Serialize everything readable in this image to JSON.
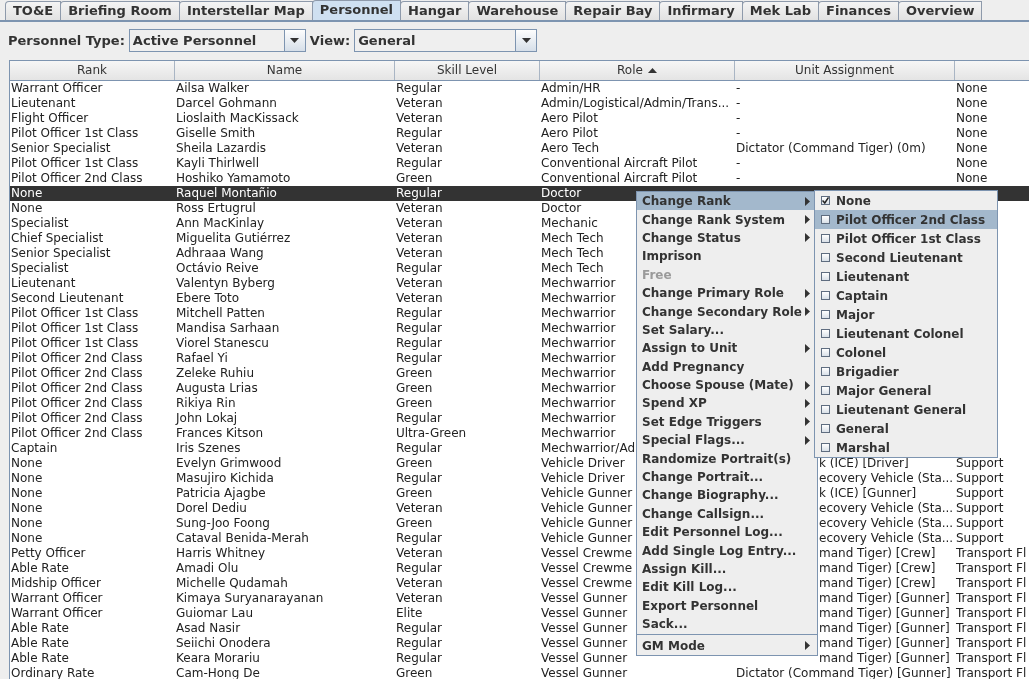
{
  "tabs": [
    {
      "label": "TO&E",
      "selected": false
    },
    {
      "label": "Briefing Room",
      "selected": false
    },
    {
      "label": "Interstellar Map",
      "selected": false
    },
    {
      "label": "Personnel",
      "selected": true
    },
    {
      "label": "Hangar",
      "selected": false
    },
    {
      "label": "Warehouse",
      "selected": false
    },
    {
      "label": "Repair Bay",
      "selected": false
    },
    {
      "label": "Infirmary",
      "selected": false
    },
    {
      "label": "Mek Lab",
      "selected": false
    },
    {
      "label": "Finances",
      "selected": false
    },
    {
      "label": "Overview",
      "selected": false
    }
  ],
  "filters": {
    "personnel_type_label": "Personnel Type:",
    "personnel_type": "Active Personnel",
    "view_label": "View:",
    "view": "General"
  },
  "table": {
    "columns": [
      {
        "label": "Rank",
        "sorted": false
      },
      {
        "label": "Name",
        "sorted": false
      },
      {
        "label": "Skill Level",
        "sorted": false
      },
      {
        "label": "Role",
        "sorted": true
      },
      {
        "label": "Unit Assignment",
        "sorted": false
      }
    ],
    "rows": [
      {
        "rank": "Warrant Officer",
        "name": "Ailsa Walker",
        "skill_level": "Regular",
        "role": "Admin/HR",
        "unit_assignment": "-",
        "column_6": "None",
        "selected": false
      },
      {
        "rank": "Lieutenant",
        "name": "Darcel Gohmann",
        "skill_level": "Veteran",
        "role": "Admin/Logistical/Admin/Trans...",
        "unit_assignment": "-",
        "column_6": "None",
        "selected": false
      },
      {
        "rank": "Flight Officer",
        "name": "Lioslaith MacKissack",
        "skill_level": "Veteran",
        "role": "Aero Pilot",
        "unit_assignment": "-",
        "column_6": "None",
        "selected": false
      },
      {
        "rank": "Pilot Officer 1st Class",
        "name": "Giselle Smith",
        "skill_level": "Regular",
        "role": "Aero Pilot",
        "unit_assignment": "-",
        "column_6": "None",
        "selected": false
      },
      {
        "rank": "Senior Specialist",
        "name": "Sheila Lazardis",
        "skill_level": "Veteran",
        "role": "Aero Tech",
        "unit_assignment": "Dictator (Command Tiger) (0m)",
        "column_6": "None",
        "selected": false
      },
      {
        "rank": "Pilot Officer 1st Class",
        "name": "Kayli Thirlwell",
        "skill_level": "Regular",
        "role": "Conventional Aircraft Pilot",
        "unit_assignment": "-",
        "column_6": "None",
        "selected": false
      },
      {
        "rank": "Pilot Officer 2nd Class",
        "name": "Hoshiko Yamamoto",
        "skill_level": "Green",
        "role": "Conventional Aircraft Pilot",
        "unit_assignment": "-",
        "column_6": "None",
        "selected": false
      },
      {
        "rank": "None",
        "name": "Raquel Montañio",
        "skill_level": "Regular",
        "role": "Doctor",
        "selected": true
      },
      {
        "rank": "None",
        "name": "Ross Ertugrul",
        "skill_level": "Veteran",
        "role": "Doctor",
        "selected": false
      },
      {
        "rank": "Specialist",
        "name": "Ann MacKinlay",
        "skill_level": "Veteran",
        "role": "Mechanic",
        "selected": false
      },
      {
        "rank": "Chief Specialist",
        "name": "Miguelita Gutiérrez",
        "skill_level": "Veteran",
        "role": "Mech Tech",
        "selected": false
      },
      {
        "rank": "Senior Specialist",
        "name": "Adhraaa Wang",
        "skill_level": "Veteran",
        "role": "Mech Tech",
        "selected": false
      },
      {
        "rank": "Specialist",
        "name": "Octávio Reive",
        "skill_level": "Regular",
        "role": "Mech Tech",
        "selected": false
      },
      {
        "rank": "Lieutenant",
        "name": "Valentyn Byberg",
        "skill_level": "Veteran",
        "role": "Mechwarrior",
        "selected": false
      },
      {
        "rank": "Second Lieutenant",
        "name": "Ebere Toto",
        "skill_level": "Veteran",
        "role": "Mechwarrior",
        "selected": false
      },
      {
        "rank": "Pilot Officer 1st Class",
        "name": "Mitchell Patten",
        "skill_level": "Regular",
        "role": "Mechwarrior",
        "selected": false
      },
      {
        "rank": "Pilot Officer 1st Class",
        "name": "Mandisa Sarhaan",
        "skill_level": "Regular",
        "role": "Mechwarrior",
        "selected": false
      },
      {
        "rank": "Pilot Officer 1st Class",
        "name": "Viorel Stanescu",
        "skill_level": "Regular",
        "role": "Mechwarrior",
        "selected": false
      },
      {
        "rank": "Pilot Officer 2nd Class",
        "name": "Rafael Yi",
        "skill_level": "Regular",
        "role": "Mechwarrior",
        "selected": false
      },
      {
        "rank": "Pilot Officer 2nd Class",
        "name": "Zeleke Ruhiu",
        "skill_level": "Green",
        "role": "Mechwarrior",
        "selected": false
      },
      {
        "rank": "Pilot Officer 2nd Class",
        "name": "Augusta Lrias",
        "skill_level": "Green",
        "role": "Mechwarrior",
        "selected": false
      },
      {
        "rank": "Pilot Officer 2nd Class",
        "name": "Rikiya Rin",
        "skill_level": "Green",
        "role": "Mechwarrior",
        "selected": false
      },
      {
        "rank": "Pilot Officer 2nd Class",
        "name": "John Lokaj",
        "skill_level": "Regular",
        "role": "Mechwarrior",
        "selected": false
      },
      {
        "rank": "Pilot Officer 2nd Class",
        "name": "Frances Kitson",
        "skill_level": "Ultra-Green",
        "role": "Mechwarrior",
        "selected": false
      },
      {
        "rank": "Captain",
        "name": "Iris Szenes",
        "skill_level": "Regular",
        "role": "Mechwarrior/Ad",
        "selected": false
      },
      {
        "rank": "None",
        "name": "Evelyn Grimwood",
        "skill_level": "Green",
        "role": "Vehicle Driver",
        "unit_assignment": "k (ICE) [Driver]",
        "column_6": "Support",
        "selected": false
      },
      {
        "rank": "None",
        "name": "Masujiro Kichida",
        "skill_level": "Regular",
        "role": "Vehicle Driver",
        "unit_assignment": "ecovery Vehicle (Sta...",
        "column_6": "Support",
        "selected": false
      },
      {
        "rank": "None",
        "name": "Patricia Ajagbe",
        "skill_level": "Green",
        "role": "Vehicle Gunner",
        "unit_assignment": "k (ICE) [Gunner]",
        "column_6": "Support",
        "selected": false
      },
      {
        "rank": "None",
        "name": "Dorel Dediu",
        "skill_level": "Veteran",
        "role": "Vehicle Gunner",
        "unit_assignment": "ecovery Vehicle (Sta...",
        "column_6": "Support",
        "selected": false
      },
      {
        "rank": "None",
        "name": "Sung-Joo Foong",
        "skill_level": "Green",
        "role": "Vehicle Gunner",
        "unit_assignment": "ecovery Vehicle (Sta...",
        "column_6": "Support",
        "selected": false
      },
      {
        "rank": "None",
        "name": "Cataval Benida-Merah",
        "skill_level": "Regular",
        "role": "Vehicle Gunner",
        "unit_assignment": "ecovery Vehicle (Sta...",
        "column_6": "Support",
        "selected": false
      },
      {
        "rank": "Petty Officer",
        "name": "Harris Whitney",
        "skill_level": "Veteran",
        "role": "Vessel Crewme",
        "unit_assignment": "mand Tiger) [Crew]",
        "column_6": "Transport Fl",
        "selected": false
      },
      {
        "rank": "Able Rate",
        "name": "Amadi Olu",
        "skill_level": "Regular",
        "role": "Vessel Crewme",
        "unit_assignment": "mand Tiger) [Crew]",
        "column_6": "Transport Fl",
        "selected": false
      },
      {
        "rank": "Midship Officer",
        "name": "Michelle Qudamah",
        "skill_level": "Veteran",
        "role": "Vessel Crewme",
        "unit_assignment": "mand Tiger) [Crew]",
        "column_6": "Transport Fl",
        "selected": false
      },
      {
        "rank": "Warrant Officer",
        "name": "Kimaya  Suryanarayanan",
        "skill_level": "Veteran",
        "role": "Vessel Gunner",
        "unit_assignment": "mand Tiger) [Gunner]",
        "column_6": "Transport Fl",
        "selected": false
      },
      {
        "rank": "Warrant Officer",
        "name": "Guiomar Lau",
        "skill_level": "Elite",
        "role": "Vessel Gunner",
        "unit_assignment": "mand Tiger) [Gunner]",
        "column_6": "Transport Fl",
        "selected": false
      },
      {
        "rank": "Able Rate",
        "name": "Asad Nasir",
        "skill_level": "Regular",
        "role": "Vessel Gunner",
        "unit_assignment": "mand Tiger) [Gunner]",
        "column_6": "Transport Fl",
        "selected": false
      },
      {
        "rank": "Able Rate",
        "name": "Seiichi Onodera",
        "skill_level": "Regular",
        "role": "Vessel Gunner",
        "unit_assignment": "mand Tiger) [Gunner]",
        "column_6": "Transport Fl",
        "selected": false
      },
      {
        "rank": "Able Rate",
        "name": "Keara Morariu",
        "skill_level": "Regular",
        "role": "Vessel Gunner",
        "unit_assignment": "mand Tiger) [Gunner]",
        "column_6": "Transport Fl",
        "selected": false
      },
      {
        "rank": "Ordinary Rate",
        "name": "Cam-Hong De",
        "skill_level": "Green",
        "role": "Vessel Gunner",
        "unit_assignment": "Dictator (Command Tiger) [Gunner]",
        "column_6": "Transport Fl",
        "selected": false
      }
    ]
  },
  "context_menu": {
    "items": [
      {
        "label": "Change Rank",
        "kind": "submenu",
        "selected": true,
        "disabled": false
      },
      {
        "label": "Change Rank System",
        "kind": "submenu",
        "selected": false,
        "disabled": false
      },
      {
        "label": "Change Status",
        "kind": "submenu",
        "selected": false,
        "disabled": false
      },
      {
        "label": "Imprison",
        "kind": "action",
        "selected": false,
        "disabled": false
      },
      {
        "label": "Free",
        "kind": "action",
        "selected": false,
        "disabled": true
      },
      {
        "label": "Change Primary Role",
        "kind": "submenu",
        "selected": false,
        "disabled": false
      },
      {
        "label": "Change Secondary Role",
        "kind": "submenu",
        "selected": false,
        "disabled": false
      },
      {
        "label": "Set Salary...",
        "kind": "action",
        "selected": false,
        "disabled": false
      },
      {
        "label": "Assign to Unit",
        "kind": "submenu",
        "selected": false,
        "disabled": false
      },
      {
        "label": "Add Pregnancy",
        "kind": "action",
        "selected": false,
        "disabled": false
      },
      {
        "label": "Choose Spouse (Mate)",
        "kind": "submenu",
        "selected": false,
        "disabled": false
      },
      {
        "label": "Spend XP",
        "kind": "submenu",
        "selected": false,
        "disabled": false
      },
      {
        "label": "Set Edge Triggers",
        "kind": "submenu",
        "selected": false,
        "disabled": false
      },
      {
        "label": "Special Flags...",
        "kind": "submenu",
        "selected": false,
        "disabled": false
      },
      {
        "label": "Randomize Portrait(s)",
        "kind": "action",
        "selected": false,
        "disabled": false
      },
      {
        "label": "Change Portrait...",
        "kind": "action",
        "selected": false,
        "disabled": false
      },
      {
        "label": "Change Biography...",
        "kind": "action",
        "selected": false,
        "disabled": false
      },
      {
        "label": "Change Callsign...",
        "kind": "action",
        "selected": false,
        "disabled": false
      },
      {
        "label": "Edit Personnel Log...",
        "kind": "action",
        "selected": false,
        "disabled": false
      },
      {
        "label": "Add Single Log Entry...",
        "kind": "action",
        "selected": false,
        "disabled": false
      },
      {
        "label": "Assign Kill...",
        "kind": "action",
        "selected": false,
        "disabled": false
      },
      {
        "label": "Edit Kill Log...",
        "kind": "action",
        "selected": false,
        "disabled": false
      },
      {
        "label": "Export Personnel",
        "kind": "action",
        "selected": false,
        "disabled": false
      },
      {
        "label": "Sack...",
        "kind": "action",
        "selected": false,
        "disabled": false
      },
      {
        "kind": "separator"
      },
      {
        "label": "GM Mode",
        "kind": "submenu",
        "selected": false,
        "disabled": false
      }
    ],
    "submenu": {
      "items": [
        {
          "label": "None",
          "checked": true,
          "selected": false
        },
        {
          "label": "Pilot Officer 2nd Class",
          "checked": false,
          "selected": true
        },
        {
          "label": "Pilot Officer 1st Class",
          "checked": false,
          "selected": false
        },
        {
          "label": "Second Lieutenant",
          "checked": false,
          "selected": false
        },
        {
          "label": "Lieutenant",
          "checked": false,
          "selected": false
        },
        {
          "label": "Captain",
          "checked": false,
          "selected": false
        },
        {
          "label": "Major",
          "checked": false,
          "selected": false
        },
        {
          "label": "Lieutenant Colonel",
          "checked": false,
          "selected": false
        },
        {
          "label": "Colonel",
          "checked": false,
          "selected": false
        },
        {
          "label": "Brigadier",
          "checked": false,
          "selected": false
        },
        {
          "label": "Major General",
          "checked": false,
          "selected": false
        },
        {
          "label": "Lieutenant General",
          "checked": false,
          "selected": false
        },
        {
          "label": "General",
          "checked": false,
          "selected": false
        },
        {
          "label": "Marshal",
          "checked": false,
          "selected": false
        }
      ]
    }
  }
}
